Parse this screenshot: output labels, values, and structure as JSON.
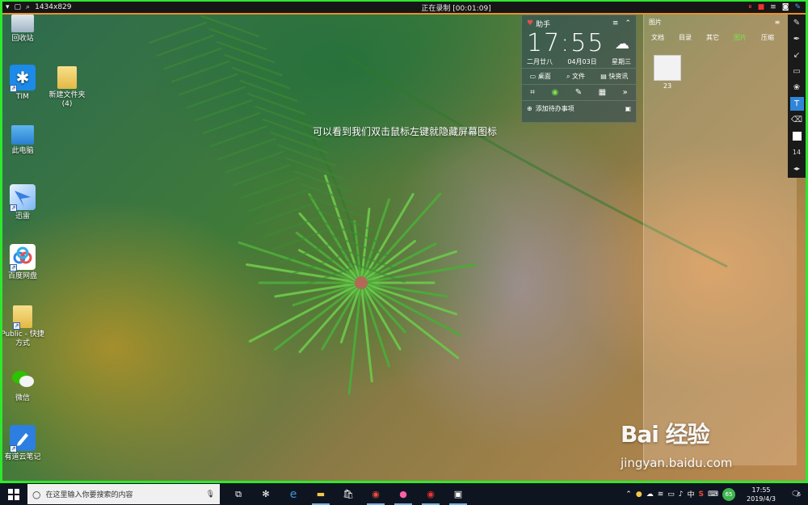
{
  "recorder": {
    "resolution": "1434x829",
    "status": "正在录制 [00:01:09]"
  },
  "desktop_icons": [
    {
      "label": "回收站",
      "icon": "recycle-bin-icon"
    },
    {
      "label": "TIM",
      "icon": "tim-icon"
    },
    {
      "label": "新建文件夹\n(4)",
      "icon": "folder-icon"
    },
    {
      "label": "此电脑",
      "icon": "this-pc-icon"
    },
    {
      "label": "迅雷",
      "icon": "xunlei-icon"
    },
    {
      "label": "百度网盘",
      "icon": "baidu-netdisk-icon"
    },
    {
      "label": "Public - 快捷\n方式",
      "icon": "folder-shortcut-icon"
    },
    {
      "label": "微信",
      "icon": "wechat-icon"
    },
    {
      "label": "有道云笔记",
      "icon": "youdao-note-icon"
    }
  ],
  "caption": "可以看到我们双击鼠标左键就隐藏屏幕图标",
  "widget": {
    "title": "助手",
    "time": "17:55",
    "lunar": "二月廿八",
    "date": "04月03日",
    "weekday": "星期三",
    "buttons": [
      "桌面",
      "文件",
      "快资讯"
    ],
    "add_todo": "添加待办事项"
  },
  "image_panel": {
    "title": "图片",
    "tabs": [
      "文档",
      "目录",
      "其它",
      "图片",
      "压缩"
    ],
    "active_tab": "图片",
    "thumb_label": "23"
  },
  "palette": {
    "font_size": "14"
  },
  "watermark": {
    "main": "Bai 经验",
    "sub": "jingyan.baidu.com"
  },
  "taskbar": {
    "search_placeholder": "在这里输入你要搜索的内容",
    "ime": "中",
    "time": "17:55",
    "date": "2019/4/3",
    "notif_count": "6",
    "badge": "65"
  },
  "colors": {
    "frame": "#2ee82e",
    "recbar_accent": "#e8902a",
    "active_tab": "#7de34a",
    "palette_active": "#2f86d8"
  }
}
